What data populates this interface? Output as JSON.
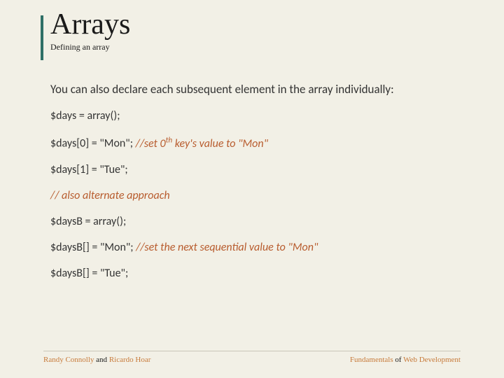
{
  "title": "Arrays",
  "subtitle": "Defining an array",
  "intro": "You can also declare each subsequent element in the array individually:",
  "lines": {
    "l1": "$days = array();",
    "l2a": "$days[0] = \"Mon\"; ",
    "l2b_pre": "//set 0",
    "l2b_sup": "th",
    "l2b_post": " key's value to \"Mon\"",
    "l3": "$days[1] = \"Tue\";",
    "l4": "// also alternate approach",
    "l5": "$daysB = array();",
    "l6a": "$daysB[] = \"Mon\"; ",
    "l6b": "//set the next sequential value to \"Mon\"",
    "l7": "$daysB[] = \"Tue\";"
  },
  "footer": {
    "left_a": "Randy Connolly",
    "left_mid": " and ",
    "left_b": "Ricardo Hoar",
    "right_a": "Fundamentals",
    "right_mid": " of ",
    "right_b": "Web Development"
  }
}
